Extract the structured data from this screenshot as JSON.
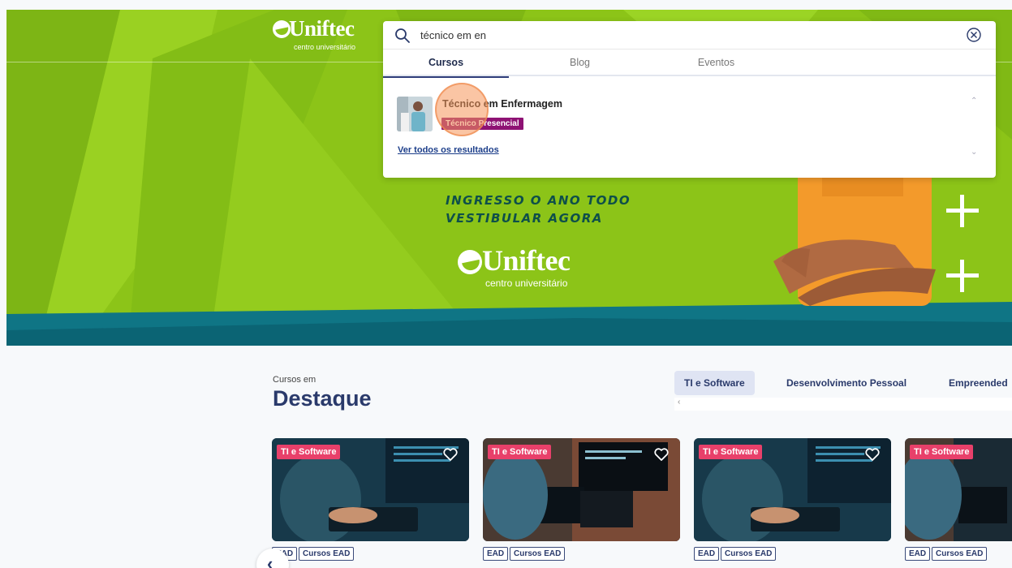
{
  "hero": {
    "logo_top": {
      "word": "Uniftec",
      "sub": "centro universitário"
    },
    "promo_line1": "INGRESSO O ANO TODO",
    "promo_line2": "VESTIBULAR AGORA",
    "logo_mid": {
      "word": "Uniftec",
      "sub": "centro universitário"
    }
  },
  "search": {
    "value": "técnico em en",
    "tabs": [
      {
        "label": "Cursos",
        "active": true
      },
      {
        "label": "Blog",
        "active": false
      },
      {
        "label": "Eventos",
        "active": false
      }
    ],
    "results": [
      {
        "title": "Técnico em Enfermagem",
        "badge": "Técnico Presencial"
      }
    ],
    "see_all": "Ver todos os resultados"
  },
  "featured": {
    "kicker": "Cursos em",
    "title": "Destaque",
    "category_tabs": [
      {
        "label": "TI e Software",
        "active": true
      },
      {
        "label": "Desenvolvimento Pessoal",
        "active": false
      },
      {
        "label": "Empreended",
        "active": false
      }
    ],
    "scroll_arrow": "‹",
    "cards": [
      {
        "tag": "TI e Software",
        "chips": [
          "EAD",
          "Cursos EAD"
        ]
      },
      {
        "tag": "TI e Software",
        "chips": [
          "EAD",
          "Cursos EAD"
        ]
      },
      {
        "tag": "TI e Software",
        "chips": [
          "EAD",
          "Cursos EAD"
        ]
      },
      {
        "tag": "TI e Software",
        "chips": [
          "EAD",
          "Cursos EAD"
        ]
      }
    ],
    "prev_arrow": "‹"
  },
  "colors": {
    "hero_green": "#8cc418",
    "hero_teal": "#0f7585",
    "brand_navy": "#2a3a6b",
    "badge_purple": "#8e1274",
    "tag_pink": "#e8406a"
  },
  "icons": {
    "search": "search-icon",
    "clear": "clear-circle-icon",
    "favorite": "heart-icon",
    "prev": "chevron-left-icon"
  }
}
